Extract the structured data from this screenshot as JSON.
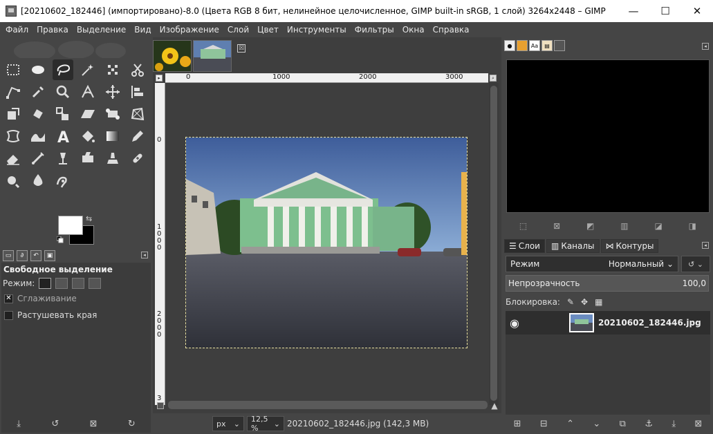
{
  "window": {
    "title": "[20210602_182446] (импортировано)-8.0 (Цвета RGB 8 бит, нелинейное целочисленное, GIMP built-in sRGB, 1 слой) 3264x2448 – GIMP",
    "minimize": "—",
    "maximize": "☐",
    "close": "✕"
  },
  "menu": [
    "Файл",
    "Правка",
    "Выделение",
    "Вид",
    "Изображение",
    "Слой",
    "Цвет",
    "Инструменты",
    "Фильтры",
    "Окна",
    "Справка"
  ],
  "toolbox": {
    "tools": [
      "rect-select",
      "ellipse-select",
      "free-select",
      "fuzzy-select",
      "select-by-color",
      "scissors-select",
      "foreground-select",
      "paths",
      "color-picker",
      "zoom",
      "measure",
      "move",
      "align",
      "crop",
      "unified-transform",
      "rotate",
      "scale",
      "shear",
      "handle-transform",
      "perspective",
      "flip",
      "cage",
      "warp",
      "text",
      "bucket-fill",
      "gradient",
      "pencil",
      "paintbrush",
      "eraser",
      "airbrush",
      "ink",
      "mypaint-brush",
      "clone",
      "heal",
      "smudge",
      "dodge-burn",
      "blur",
      "gegl"
    ],
    "active_tool_index": 2,
    "fg_color": "#ffffff",
    "bg_color": "#000000",
    "options_title": "Свободное выделение",
    "mode_label": "Режим:",
    "antialias_label": "Сглаживание",
    "antialias_checked": true,
    "feather_label": "Растушевать края",
    "feather_checked": false
  },
  "canvas": {
    "ruler_h": [
      "0",
      "1000",
      "2000",
      "3000"
    ],
    "ruler_v": [
      "0",
      "1000",
      "2000",
      "3"
    ],
    "unit": "px",
    "zoom": "12,5 %",
    "status": "20210602_182446.jpg (142,3 MB)",
    "close_tab": "☒"
  },
  "dock": {
    "tabs": [
      "Слои",
      "Каналы",
      "Контуры"
    ],
    "mode_label": "Режим",
    "mode_value": "Нормальный",
    "opacity_label": "Непрозрачность",
    "opacity_value": "100,0",
    "lock_label": "Блокировка:",
    "layer_name": "20210602_182446.jpg"
  }
}
